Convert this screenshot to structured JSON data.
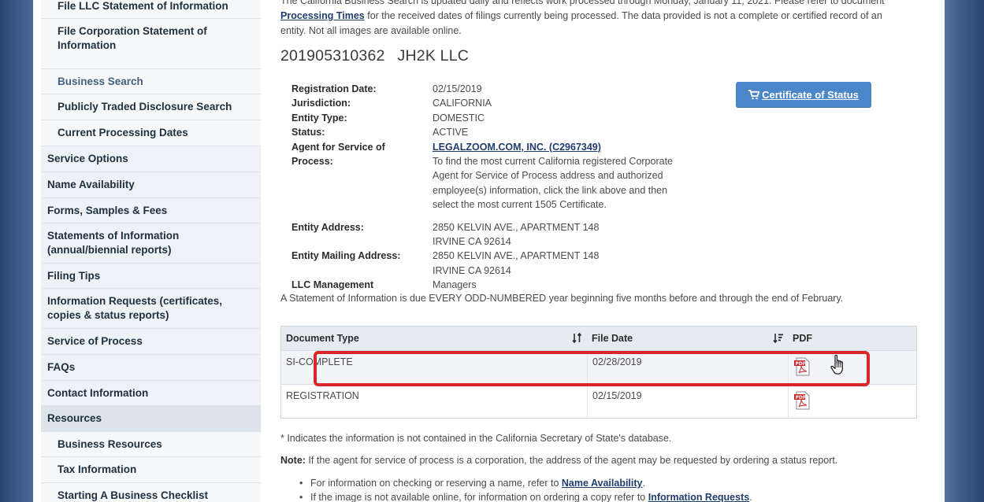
{
  "sidebar": {
    "items": [
      {
        "label": "File LLC Statement of Information",
        "level": "sub"
      },
      {
        "label": "File Corporation Statement of Information",
        "level": "sub"
      },
      {
        "label": "Business Search",
        "level": "sub",
        "active": true
      },
      {
        "label": "Publicly Traded Disclosure Search",
        "level": "sub"
      },
      {
        "label": "Current Processing Dates",
        "level": "sub"
      },
      {
        "label": "Service Options",
        "level": "top"
      },
      {
        "label": "Name Availability",
        "level": "top"
      },
      {
        "label": "Forms, Samples & Fees",
        "level": "top"
      },
      {
        "label": "Statements of Information (annual/biennial reports)",
        "level": "top"
      },
      {
        "label": "Filing Tips",
        "level": "top"
      },
      {
        "label": "Information Requests (certificates, copies & status reports)",
        "level": "top"
      },
      {
        "label": "Service of Process",
        "level": "top"
      },
      {
        "label": "FAQs",
        "level": "top"
      },
      {
        "label": "Contact Information",
        "level": "top"
      },
      {
        "label": "Resources",
        "level": "top"
      },
      {
        "label": "Business Resources",
        "level": "sub"
      },
      {
        "label": "Tax Information",
        "level": "sub"
      },
      {
        "label": "Starting A Business Checklist",
        "level": "sub"
      }
    ]
  },
  "intro": {
    "line1": "The California Business Search is updated daily and reflects work processed through Monday, January 11, 2021. Please refer to document",
    "link": "Processing Times",
    "line2": " for the received dates of filings currently being processed. The data provided is not a complete or certified record of an",
    "line3": "entity. Not all images are available online."
  },
  "entity": {
    "number": "201905310362",
    "name": "JH2K LLC"
  },
  "details": {
    "registration_date_label": "Registration Date:",
    "registration_date": "02/15/2019",
    "jurisdiction_label": "Jurisdiction:",
    "jurisdiction": "CALIFORNIA",
    "entity_type_label": "Entity Type:",
    "entity_type": "DOMESTIC",
    "status_label": "Status:",
    "status": "ACTIVE",
    "agent_label_1": "Agent for Service of",
    "agent_label_2": "Process:",
    "agent_link": "LEGALZOOM.COM, INC. (C2967349)",
    "agent_note_1": "To find the most current California registered Corporate",
    "agent_note_2": "Agent for Service of Process address and authorized",
    "agent_note_3": "employee(s) information, click the link above and then",
    "agent_note_4": "select the most current 1505 Certificate.",
    "entity_address_label": "Entity Address:",
    "entity_address_1": "2850 KELVIN AVE., APARTMENT 148",
    "entity_address_2": "IRVINE CA 92614",
    "mailing_address_label": "Entity Mailing Address:",
    "mailing_address_1": "2850 KELVIN AVE., APARTMENT 148",
    "mailing_address_2": "IRVINE CA 92614",
    "llc_management_label": "LLC Management",
    "llc_management": "Managers"
  },
  "certificate_button": "Certificate of Status",
  "soi_note": "A Statement of Information is due EVERY ODD-NUMBERED year beginning five months before and through the end of February.",
  "documents": {
    "headers": {
      "type": "Document Type",
      "date": "File Date",
      "pdf": "PDF"
    },
    "rows": [
      {
        "type": "SI-COMPLETE",
        "date": "02/28/2019"
      },
      {
        "type": "REGISTRATION",
        "date": "02/15/2019"
      }
    ]
  },
  "footer": {
    "asterisk_note": "* Indicates the information is not contained in the California Secretary of State's database.",
    "note_label": "Note:",
    "note_text": " If the agent for service of process is a corporation, the address of the agent may be requested by ordering a status report.",
    "bullet1_text": "For information on checking or reserving a name, refer to ",
    "bullet1_link": "Name Availability",
    "bullet1_end": ".",
    "bullet2_text": "If the image is not available online, for information on ordering a copy refer to ",
    "bullet2_link": "Information Requests",
    "bullet2_end": "."
  },
  "colors": {
    "accent_button": "#4b86c9",
    "highlight": "#d9262b",
    "link": "#1f3d6e"
  }
}
